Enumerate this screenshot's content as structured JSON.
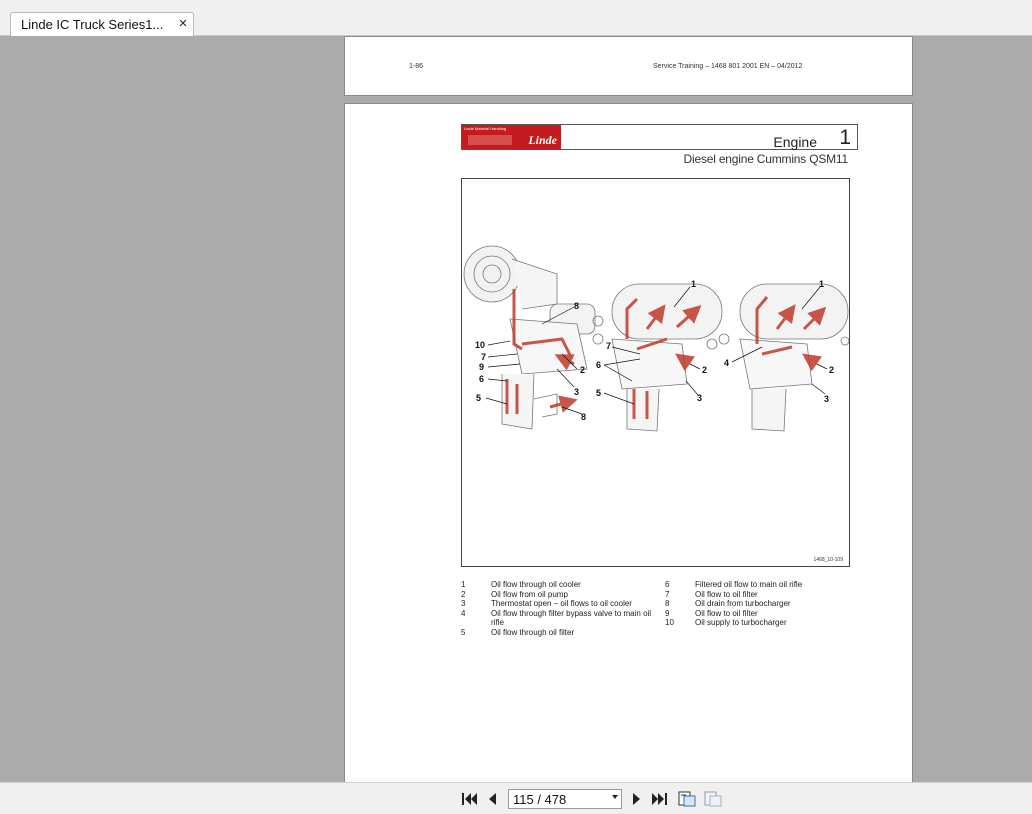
{
  "tab": {
    "title": "Linde IC Truck Series1...",
    "close_label": "×"
  },
  "prev_page": {
    "page_number": "1-86",
    "footer": "Service Training – 1468 801 2001 EN – 04/2012"
  },
  "page": {
    "logo_tag": "Linde Material Handling",
    "logo_brand": "Linde",
    "section_title": "Engine",
    "section_number": "1",
    "subtitle": "Diesel engine Cummins QSM11",
    "figure_id": "1468_10-109",
    "figure_callouts": {
      "left": [
        "10",
        "7",
        "9",
        "6",
        "5",
        "8",
        "2",
        "3",
        "8"
      ],
      "middle": [
        "1",
        "7",
        "6",
        "5",
        "2",
        "3"
      ],
      "right": [
        "1",
        "4",
        "2",
        "3"
      ]
    },
    "legend_left": [
      {
        "num": "1",
        "text": "Oil flow through oil cooler"
      },
      {
        "num": "2",
        "text": "Oil flow from oil pump"
      },
      {
        "num": "3",
        "text": "Thermostat open – oil flows to oil cooler"
      },
      {
        "num": "4",
        "text": "Oil flow through filter bypass valve to main oil",
        "text2": "rifle"
      },
      {
        "num": "5",
        "text": "Oil flow through oil filter"
      }
    ],
    "legend_right": [
      {
        "num": "6",
        "text": "Filtered oil flow to main oil rifle"
      },
      {
        "num": "7",
        "text": "Oil flow to oil filter"
      },
      {
        "num": "8",
        "text": "Oil drain from turbocharger"
      },
      {
        "num": "9",
        "text": "Oil flow to oil filter"
      },
      {
        "num": "10",
        "text": "Oil supply to turbocharger"
      }
    ]
  },
  "toolbar": {
    "page_indicator": "115 / 478",
    "icons": [
      "first-page-icon",
      "prev-page-icon",
      "next-page-icon",
      "last-page-icon",
      "fit-page-icon",
      "fit-width-icon"
    ]
  }
}
